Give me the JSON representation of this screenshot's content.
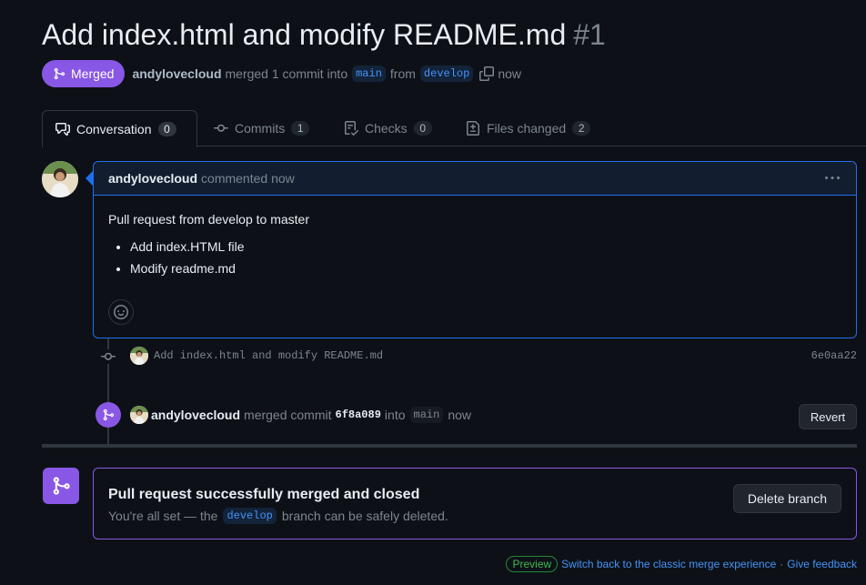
{
  "pr": {
    "title": "Add index.html and modify README.md",
    "number": "#1",
    "state": "Merged",
    "author": "andylovecloud",
    "action_text": "merged 1 commit into",
    "base_branch": "main",
    "from_text": "from",
    "head_branch": "develop",
    "time": "now"
  },
  "tabs": [
    {
      "label": "Conversation",
      "count": "0",
      "icon": "comment-discussion-icon"
    },
    {
      "label": "Commits",
      "count": "1",
      "icon": "git-commit-icon"
    },
    {
      "label": "Checks",
      "count": "0",
      "icon": "checklist-icon"
    },
    {
      "label": "Files changed",
      "count": "2",
      "icon": "file-diff-icon"
    }
  ],
  "comment": {
    "author": "andylovecloud",
    "meta": "commented now",
    "body_intro": "Pull request from develop to master",
    "items": [
      "Add index.HTML file",
      "Modify readme.md"
    ]
  },
  "commit": {
    "message": "Add index.html and modify README.md",
    "sha": "6e0aa22"
  },
  "merge_event": {
    "author": "andylovecloud",
    "text1": "merged commit",
    "sha": "6f8a089",
    "text2": "into",
    "branch": "main",
    "time": "now",
    "revert_label": "Revert"
  },
  "merge_box": {
    "title": "Pull request successfully merged and closed",
    "sub_before": "You're all set — the",
    "branch": "develop",
    "sub_after": "branch can be safely deleted.",
    "delete_label": "Delete branch"
  },
  "footer": {
    "preview": "Preview",
    "switch_link": "Switch back to the classic merge experience",
    "separator": "·",
    "feedback_link": "Give feedback"
  },
  "colors": {
    "background": "#0d1117",
    "merged_purple": "#8957e5",
    "link_blue": "#4493f8",
    "border": "#30363d"
  }
}
